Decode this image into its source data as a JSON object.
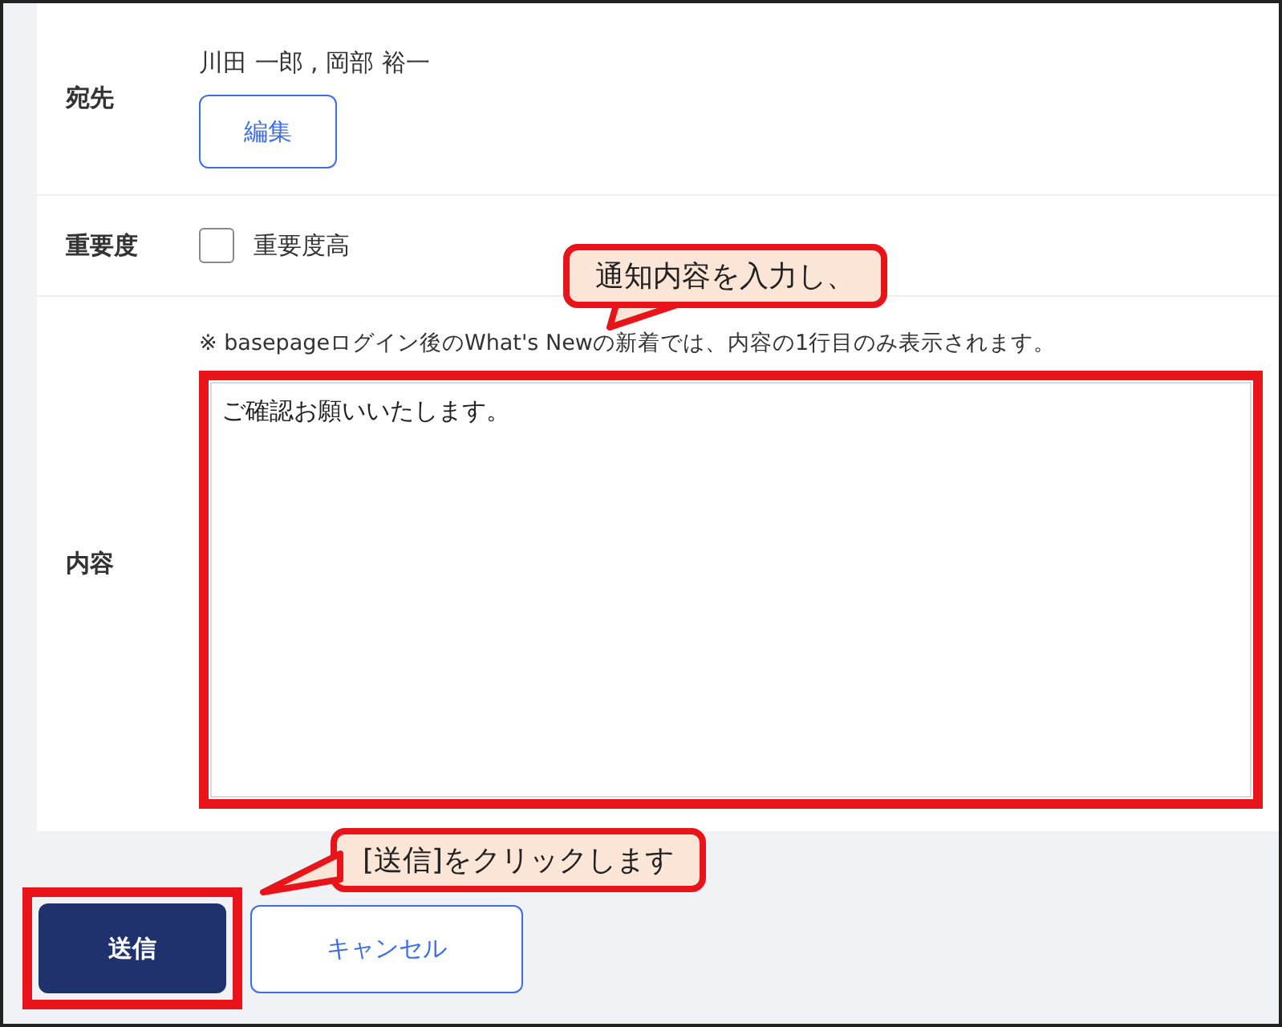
{
  "form": {
    "rows": [
      {
        "kind": "recipients",
        "label": "宛先",
        "value": "川田 一郎 , 岡部 裕一",
        "button": "編集"
      },
      {
        "kind": "checkbox",
        "label": "重要度",
        "option": "重要度高",
        "checked": false
      },
      {
        "kind": "textarea",
        "label": "内容",
        "note": "※ basepageログイン後のWhat's Newの新着では、内容の1行目のみ表示されます。",
        "value": "ご確認お願いいたします。"
      }
    ]
  },
  "buttons": [
    {
      "kind": "primary",
      "label": "送信"
    },
    {
      "kind": "secondary",
      "label": "キャンセル"
    }
  ],
  "callouts": [
    {
      "text": "通知内容を入力し、"
    },
    {
      "text": "[送信]をクリックします"
    }
  ]
}
